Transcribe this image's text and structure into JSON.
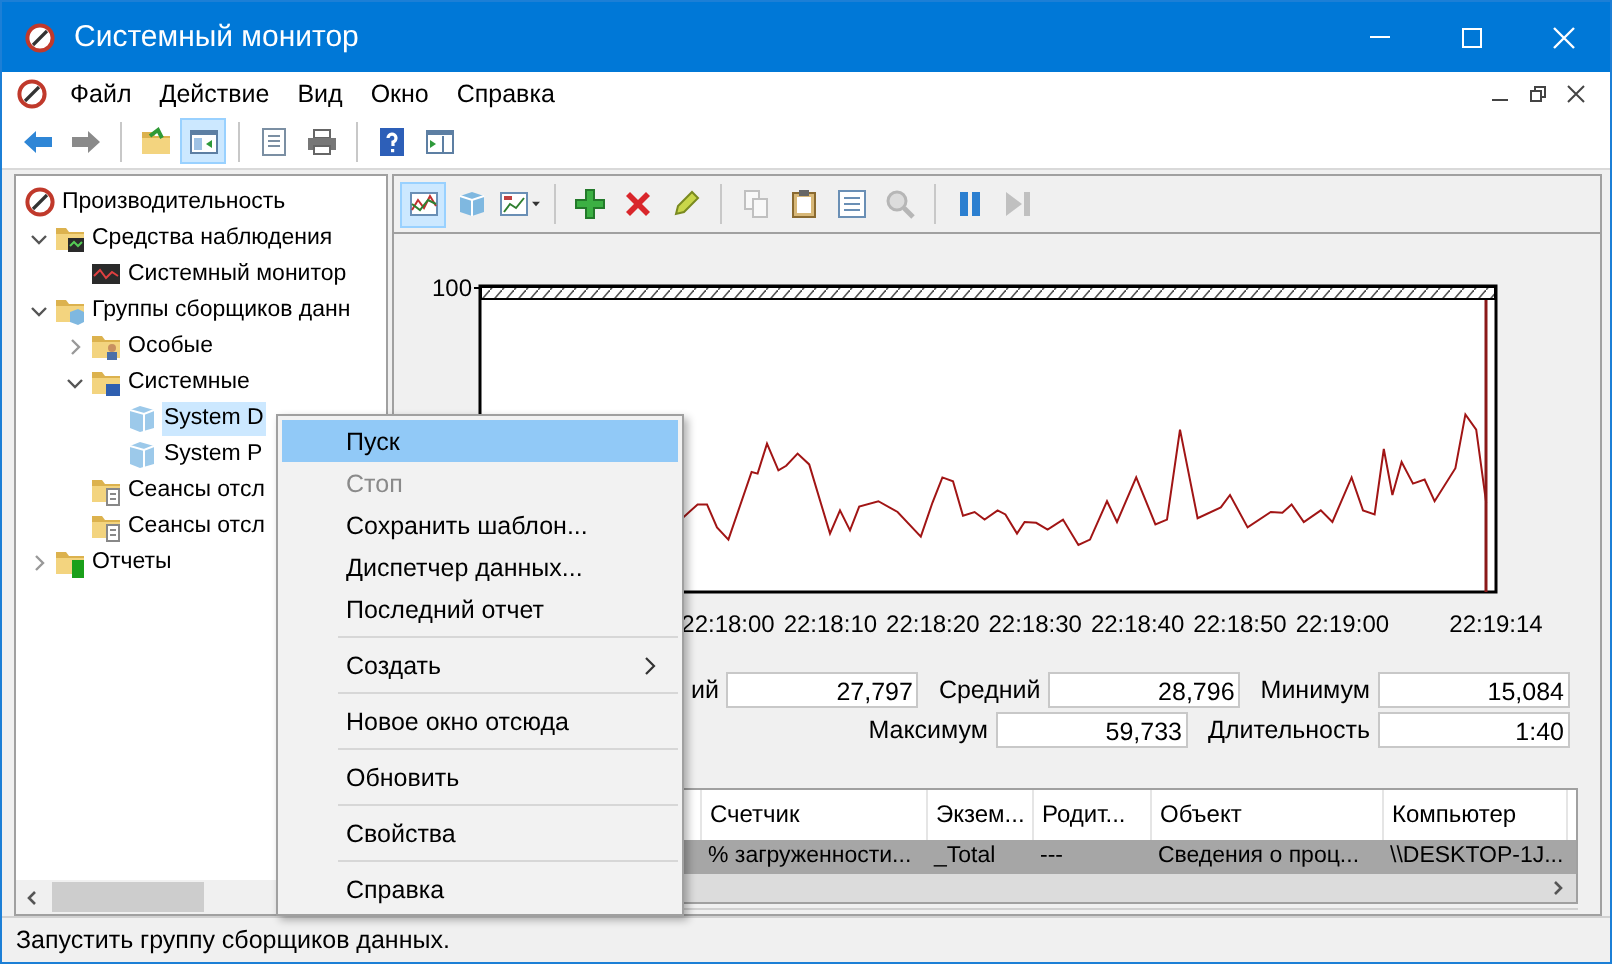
{
  "window": {
    "title": "Системный монитор"
  },
  "menu_bar": [
    "Файл",
    "Действие",
    "Вид",
    "Окно",
    "Справка"
  ],
  "toolbar": [
    {
      "kind": "back",
      "pressed": false
    },
    {
      "kind": "forward",
      "pressed": false
    },
    {
      "kind": "separator"
    },
    {
      "kind": "up-folder",
      "pressed": false
    },
    {
      "kind": "console-tree",
      "pressed": true
    },
    {
      "kind": "separator"
    },
    {
      "kind": "export",
      "pressed": false
    },
    {
      "kind": "print",
      "pressed": false
    },
    {
      "kind": "separator"
    },
    {
      "kind": "help",
      "pressed": false
    },
    {
      "kind": "action-pane",
      "pressed": false
    }
  ],
  "tree": [
    {
      "label": "Производительность",
      "kind": "app",
      "selected": false,
      "children": [
        {
          "label": "Средства наблюдения",
          "kind": "tools",
          "expanded": true,
          "selected": false,
          "children": [
            {
              "label": "Системный монитор",
              "kind": "monitor",
              "selected": false
            }
          ]
        },
        {
          "label": "Группы сборщиков данн",
          "kind": "group-folder",
          "expanded": true,
          "selected": false,
          "children": [
            {
              "label": "Особые",
              "kind": "user-folder",
              "expanded": false,
              "selected": false
            },
            {
              "label": "Системные",
              "kind": "system-folder",
              "expanded": true,
              "selected": false,
              "children": [
                {
                  "label": "System D",
                  "kind": "collector",
                  "selected": true
                },
                {
                  "label": "System P",
                  "kind": "collector",
                  "selected": false
                }
              ]
            },
            {
              "label": "Сеансы отсл",
              "kind": "trace-folder",
              "selected": false
            },
            {
              "label": "Сеансы отсл",
              "kind": "trace-folder",
              "selected": false
            }
          ]
        },
        {
          "label": "Отчеты",
          "kind": "report-folder",
          "expanded": false,
          "selected": false
        }
      ]
    }
  ],
  "chart_toolbar": [
    {
      "kind": "graph",
      "pressed": true,
      "disabled": false
    },
    {
      "kind": "cube",
      "pressed": false,
      "disabled": false
    },
    {
      "kind": "chart-type",
      "pressed": false,
      "disabled": false
    },
    {
      "kind": "separator"
    },
    {
      "kind": "add",
      "pressed": false,
      "disabled": false
    },
    {
      "kind": "delete",
      "pressed": false,
      "disabled": false
    },
    {
      "kind": "pencil",
      "pressed": false,
      "disabled": false
    },
    {
      "kind": "separator"
    },
    {
      "kind": "copy",
      "pressed": false,
      "disabled": true
    },
    {
      "kind": "paste",
      "pressed": false,
      "disabled": false
    },
    {
      "kind": "properties",
      "pressed": false,
      "disabled": false
    },
    {
      "kind": "zoom",
      "pressed": false,
      "disabled": true
    },
    {
      "kind": "separator"
    },
    {
      "kind": "freeze",
      "pressed": false,
      "disabled": false
    },
    {
      "kind": "update",
      "pressed": false,
      "disabled": true
    }
  ],
  "graph": {
    "y_label": "100",
    "x_labels": [
      "22:18:00",
      "22:18:10",
      "22:18:20",
      "22:18:30",
      "22:18:40",
      "22:18:50",
      "22:19:00",
      "22:19:14"
    ]
  },
  "stat_rows": [
    {
      "items": [
        {
          "label": "ий",
          "value": "27,797"
        },
        {
          "label": "Средний",
          "value": "28,796"
        },
        {
          "label": "Минимум",
          "value": "15,084"
        }
      ]
    },
    {
      "items": [
        {
          "label": "Максимум",
          "value": "59,733"
        },
        {
          "label": "Длительность",
          "value": "1:40"
        }
      ]
    }
  ],
  "table": {
    "columns": [
      "Счетчик",
      "Экзем...",
      "Родит...",
      "Объект",
      "Компьютер"
    ],
    "rows": [
      {
        "cells": [
          "% загруженности...",
          "_Total",
          "---",
          "Сведения о проц...",
          "\\\\DESKTOP-1J..."
        ],
        "selected": true
      }
    ]
  },
  "context_menu": [
    {
      "kind": "item",
      "label": "Пуск",
      "selected": true,
      "disabled": false
    },
    {
      "kind": "item",
      "label": "Стоп",
      "selected": false,
      "disabled": true
    },
    {
      "kind": "item",
      "label": "Сохранить шаблон...",
      "selected": false,
      "disabled": false
    },
    {
      "kind": "item",
      "label": "Диспетчер данных...",
      "selected": false,
      "disabled": false
    },
    {
      "kind": "item",
      "label": "Последний отчет",
      "selected": false,
      "disabled": false
    },
    {
      "kind": "separator"
    },
    {
      "kind": "submenu",
      "label": "Создать",
      "selected": false,
      "disabled": false
    },
    {
      "kind": "separator"
    },
    {
      "kind": "item",
      "label": "Новое окно отсюда",
      "selected": false,
      "disabled": false
    },
    {
      "kind": "separator"
    },
    {
      "kind": "item",
      "label": "Обновить",
      "selected": false,
      "disabled": false
    },
    {
      "kind": "separator"
    },
    {
      "kind": "item",
      "label": "Свойства",
      "selected": false,
      "disabled": false
    },
    {
      "kind": "separator"
    },
    {
      "kind": "item",
      "label": "Справка",
      "selected": false,
      "disabled": false
    }
  ],
  "status_bar": "Запустить группу сборщиков данных."
}
